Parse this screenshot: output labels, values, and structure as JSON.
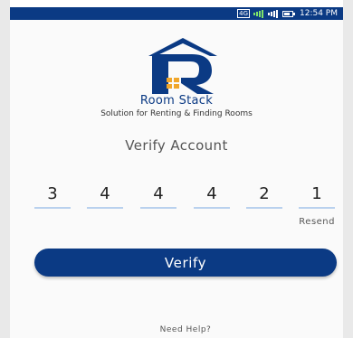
{
  "status_bar": {
    "network_type": "4G",
    "time": "12:54 PM",
    "bg_color": "#0b3a84"
  },
  "app": {
    "brand_name": "Room Stack",
    "tagline": "Solution for Renting & Finding Rooms",
    "brand_color": "#0b3a84",
    "logo_icon": "house-r-logo-icon"
  },
  "screen": {
    "title": "Verify Account"
  },
  "otp": {
    "digits": [
      "3",
      "4",
      "4",
      "4",
      "2",
      "1"
    ]
  },
  "actions": {
    "resend_label": "Resend",
    "verify_label": "Verify",
    "help_label": "Need Help?"
  }
}
